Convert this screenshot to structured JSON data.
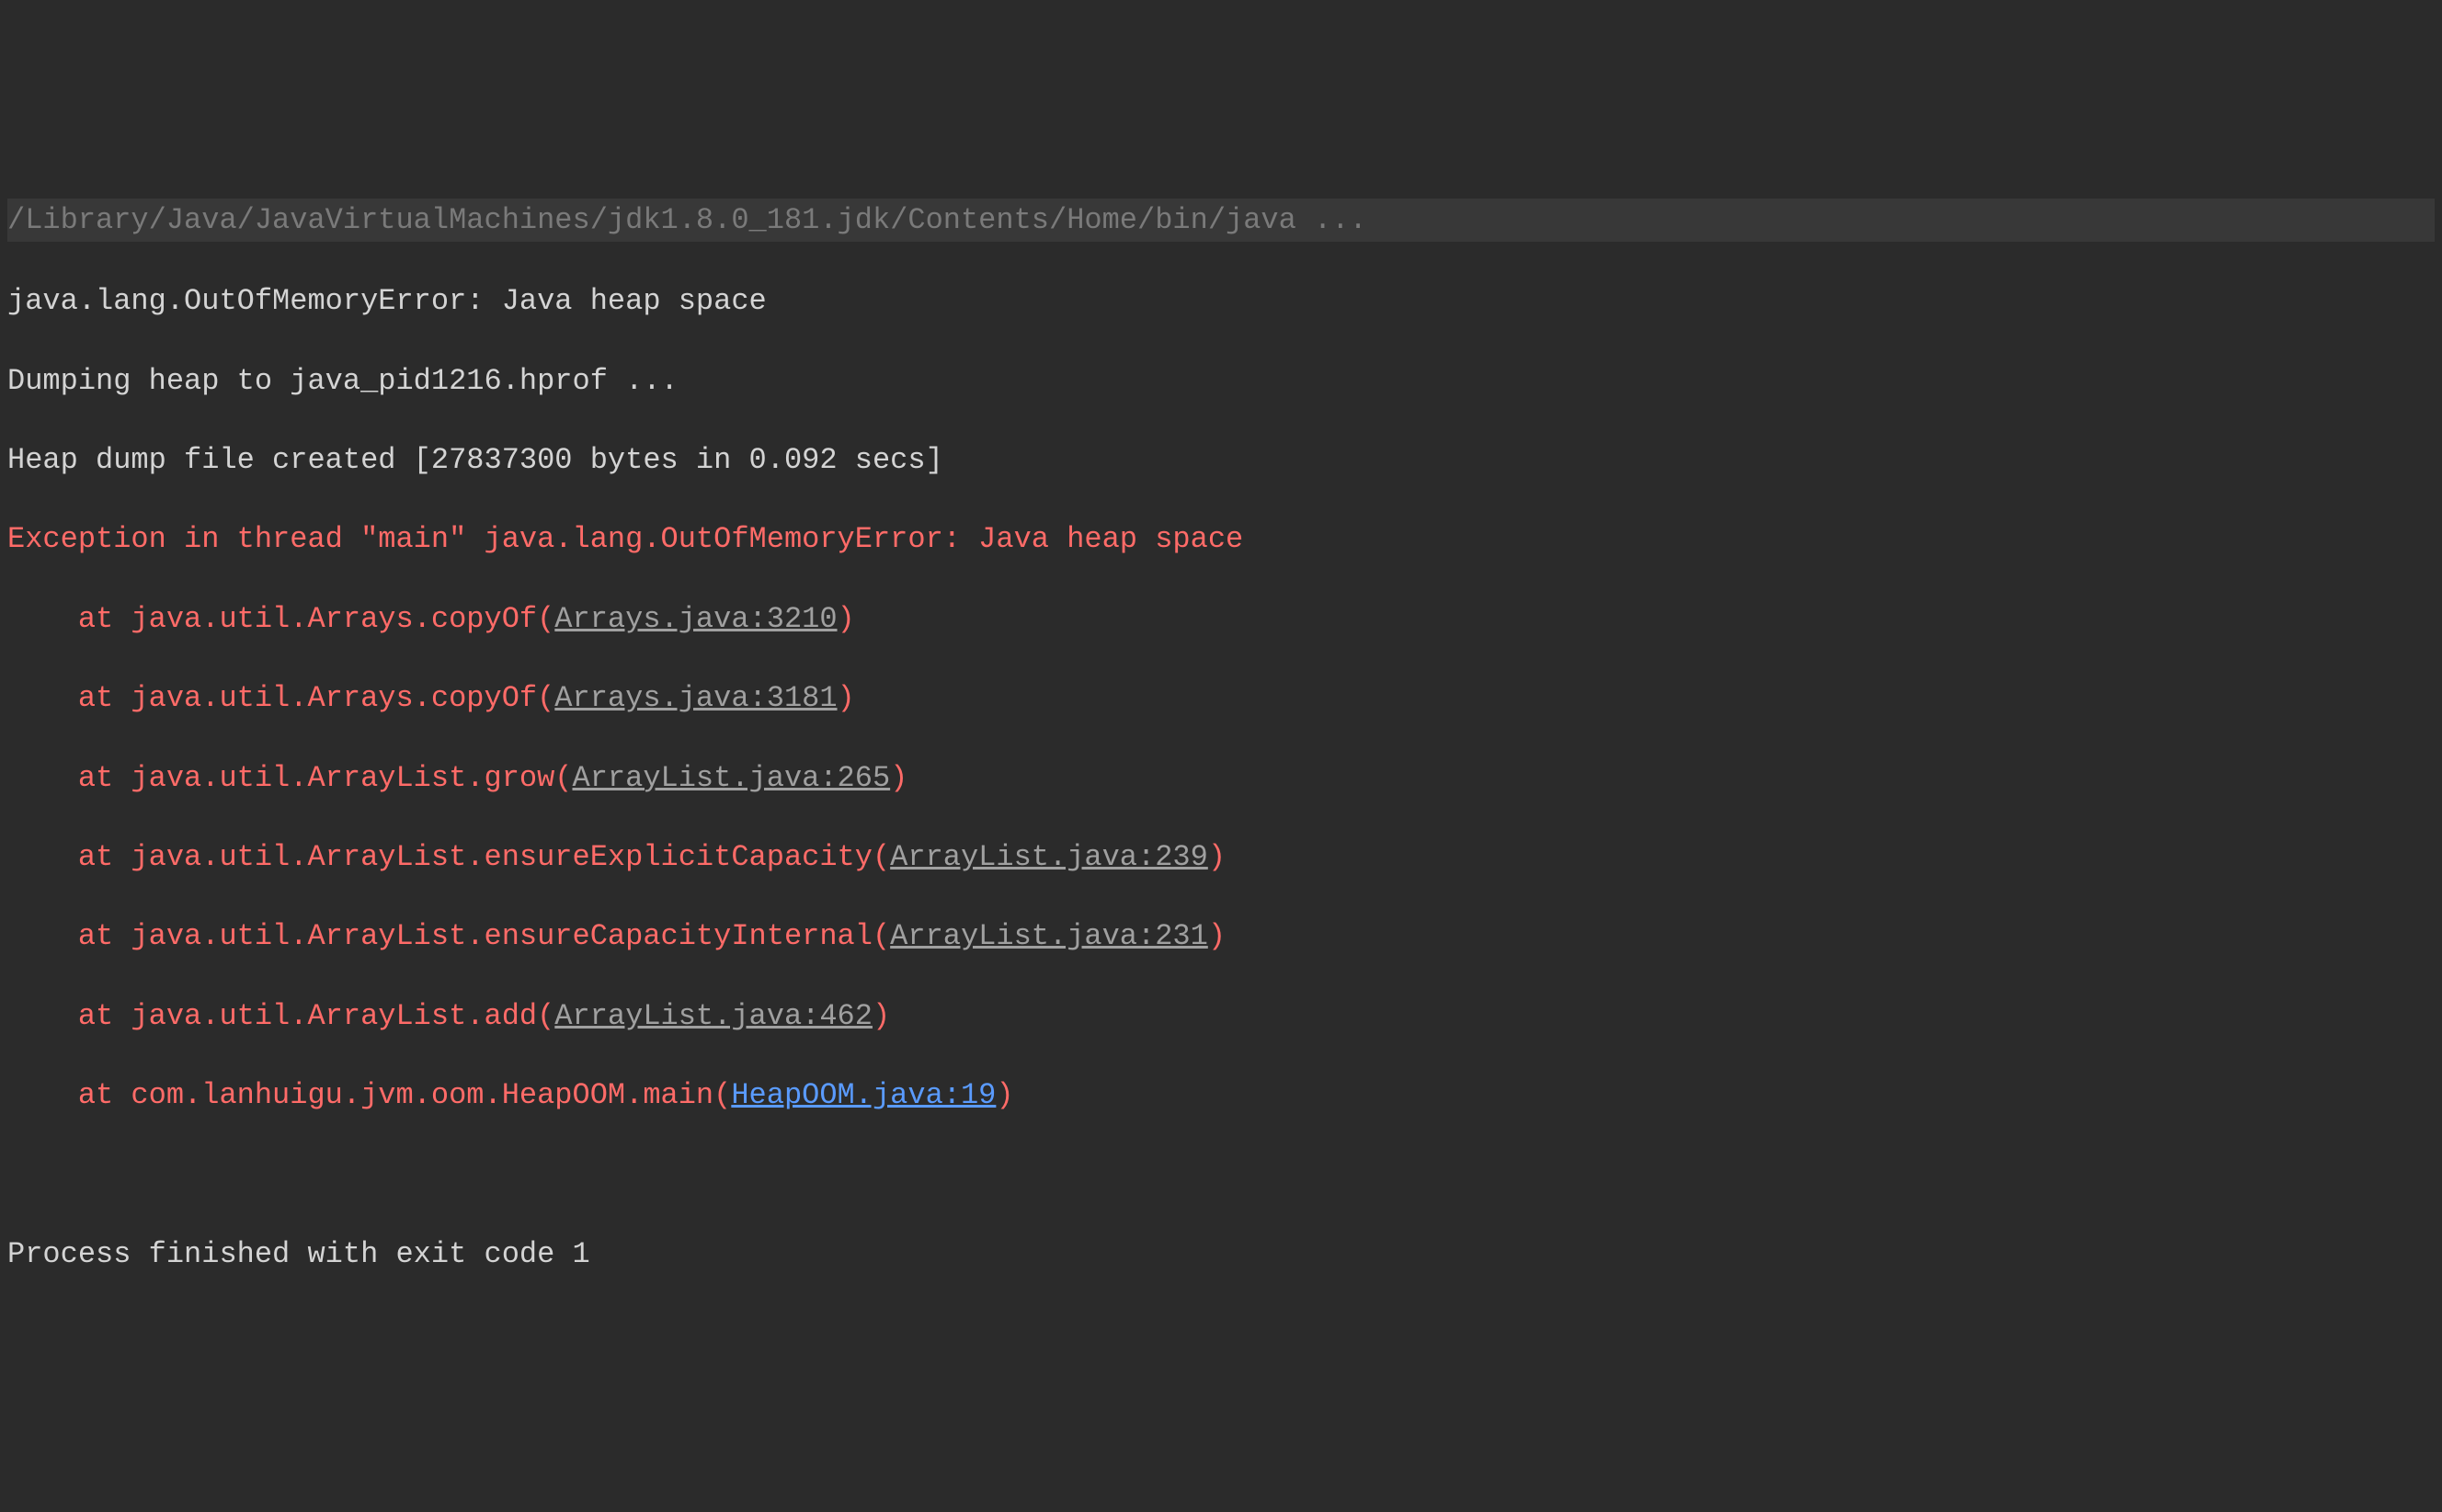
{
  "console": {
    "command_line": "/Library/Java/JavaVirtualMachines/jdk1.8.0_181.jdk/Contents/Home/bin/java ...",
    "line1": "java.lang.OutOfMemoryError: Java heap space",
    "line2": "Dumping heap to java_pid1216.hprof ...",
    "line3": "Heap dump file created [27837300 bytes in 0.092 secs]",
    "exception_header": "Exception in thread \"main\" java.lang.OutOfMemoryError: Java heap space",
    "stack": [
      {
        "at": "at ",
        "method": "java.util.Arrays.copyOf(",
        "link": "Arrays.java:3210",
        "close": ")",
        "link_style": "gray"
      },
      {
        "at": "at ",
        "method": "java.util.Arrays.copyOf(",
        "link": "Arrays.java:3181",
        "close": ")",
        "link_style": "gray"
      },
      {
        "at": "at ",
        "method": "java.util.ArrayList.grow(",
        "link": "ArrayList.java:265",
        "close": ")",
        "link_style": "gray"
      },
      {
        "at": "at ",
        "method": "java.util.ArrayList.ensureExplicitCapacity(",
        "link": "ArrayList.java:239",
        "close": ")",
        "link_style": "gray"
      },
      {
        "at": "at ",
        "method": "java.util.ArrayList.ensureCapacityInternal(",
        "link": "ArrayList.java:231",
        "close": ")",
        "link_style": "gray"
      },
      {
        "at": "at ",
        "method": "java.util.ArrayList.add(",
        "link": "ArrayList.java:462",
        "close": ")",
        "link_style": "gray"
      },
      {
        "at": "at ",
        "method": "com.lanhuigu.jvm.oom.HeapOOM.main(",
        "link": "HeapOOM.java:19",
        "close": ")",
        "link_style": "blue"
      }
    ],
    "indent": "    ",
    "exit_line": "Process finished with exit code 1"
  }
}
